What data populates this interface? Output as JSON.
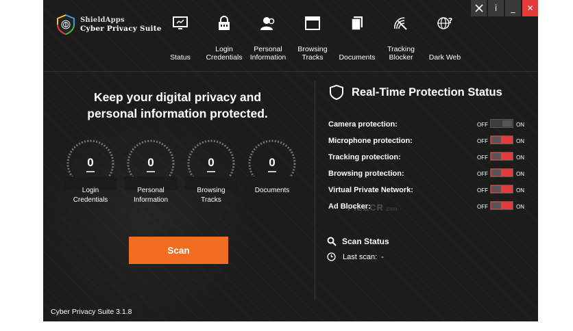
{
  "brand": {
    "line1": "ShieldApps",
    "line2": "Cyber Privacy Suite"
  },
  "nav": [
    {
      "label": "Status",
      "icon": "monitor-icon",
      "active": true
    },
    {
      "label": "Login\nCredentials",
      "icon": "lock-icon"
    },
    {
      "label": "Personal\nInformation",
      "icon": "user-icon"
    },
    {
      "label": "Browsing\nTracks",
      "icon": "browser-window-icon"
    },
    {
      "label": "Documents",
      "icon": "documents-icon"
    },
    {
      "label": "Tracking\nBlocker",
      "icon": "radar-icon"
    },
    {
      "label": "Dark Web",
      "icon": "globe-question-icon"
    }
  ],
  "window_controls": {
    "tools": "✕",
    "info": "i",
    "minimize": "_",
    "close": "✕"
  },
  "headline": "Keep your digital privacy and\npersonal information protected.",
  "gauges": [
    {
      "count": "0",
      "label": "Login\nCredentials"
    },
    {
      "count": "0",
      "label": "Personal\nInformation"
    },
    {
      "count": "0",
      "label": "Browsing\nTracks"
    },
    {
      "count": "0",
      "label": "Documents"
    }
  ],
  "scan_button": "Scan",
  "version": "Cyber Privacy Suite 3.1.8",
  "realtime": {
    "title": "Real-Time Protection Status",
    "off_label": "OFF",
    "on_label": "ON",
    "items": [
      {
        "label": "Camera protection:",
        "enabled": false
      },
      {
        "label": "Microphone protection:",
        "enabled": true
      },
      {
        "label": "Tracking protection:",
        "enabled": true
      },
      {
        "label": "Browsing protection:",
        "enabled": true
      },
      {
        "label": "Virtual Private Network:",
        "enabled": true
      },
      {
        "label": "Ad Blocker:",
        "enabled": true
      }
    ]
  },
  "scan_status": {
    "title": "Scan Status",
    "last_scan": "Last scan:  -"
  },
  "watermark": {
    "main": "FILECR",
    "sub": ".com"
  },
  "colors": {
    "accent": "#f26c22",
    "toggle_on": "#e43b3b",
    "background": "#1c1c1c"
  }
}
